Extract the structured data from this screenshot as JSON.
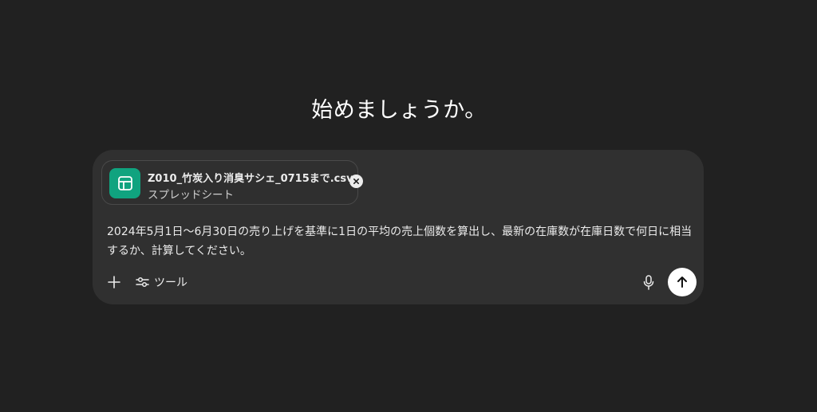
{
  "heading": "始めましょうか。",
  "attachment": {
    "file_name": "Z010_竹炭入り消臭サシェ_0715まで.csv",
    "file_type": "スプレッドシート",
    "icon": "spreadsheet-icon",
    "icon_color": "#10a37f"
  },
  "composer": {
    "prompt_text": "2024年5月1日～6月30日の売り上げを基準に1日の平均の売上個数を算出し、最新の在庫数が在庫日数で何日に相当するか、計算してください。",
    "tools_label": "ツール",
    "plus_icon": "plus-icon",
    "tools_icon": "sliders-icon",
    "mic_icon": "microphone-icon",
    "send_icon": "arrow-up-icon"
  },
  "colors": {
    "background": "#212121",
    "composer": "#303030",
    "accent": "#10a37f"
  }
}
